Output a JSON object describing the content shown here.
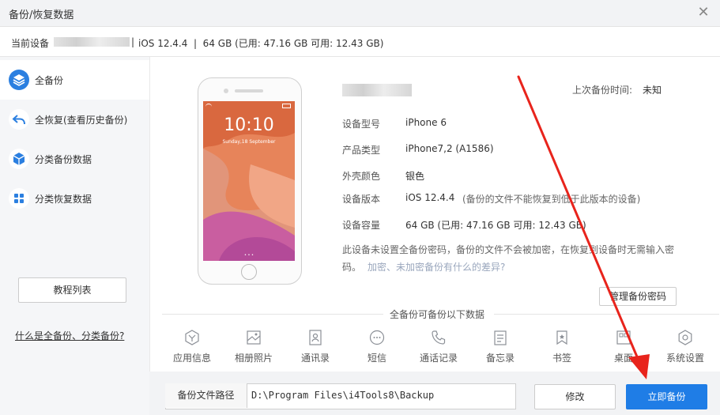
{
  "window": {
    "title": "备份/恢复数据",
    "close_icon": "close-icon"
  },
  "device_bar": {
    "label": "当前设备",
    "separator": "|",
    "info": "iOS 12.4.4  |  64 GB (已用: 47.16 GB 可用: 12.43 GB)"
  },
  "sidebar": {
    "items": [
      {
        "label": "全备份",
        "icon": "layers-icon",
        "active": true
      },
      {
        "label": "全恢复(查看历史备份)",
        "icon": "undo-icon",
        "active": false
      },
      {
        "label": "分类备份数据",
        "icon": "cube-icon",
        "active": false
      },
      {
        "label": "分类恢复数据",
        "icon": "grid-icon",
        "active": false
      }
    ],
    "tutorial_label": "教程列表",
    "faq_link": "什么是全备份、分类备份?"
  },
  "phone": {
    "time": "10:10",
    "date": "Sunday,18 September",
    "page_dots": "• • •"
  },
  "device_info": {
    "last_backup_label": "上次备份时间:",
    "last_backup_value": "未知",
    "rows": [
      {
        "label": "设备型号",
        "value": "iPhone 6"
      },
      {
        "label": "产品类型",
        "value": "iPhone7,2 (A1586)"
      },
      {
        "label": "外壳颜色",
        "value": "银色"
      },
      {
        "label": "设备版本",
        "value": "iOS 12.4.4",
        "note": "(备份的文件不能恢复到低于此版本的设备)"
      },
      {
        "label": "设备容量",
        "value": "64 GB (已用: 47.16 GB  可用: 12.43 GB)"
      }
    ],
    "password_note": "此设备未设置全备份密码，备份的文件不会被加密，在恢复到设备时无需输入密码。",
    "password_link": "加密、未加密备份有什么的差异?",
    "manage_password_button": "管理备份密码"
  },
  "backup_scope": {
    "title": "全备份可备份以下数据",
    "categories": [
      {
        "label": "应用信息",
        "icon": "app-icon"
      },
      {
        "label": "相册照片",
        "icon": "photo-icon"
      },
      {
        "label": "通讯录",
        "icon": "contacts-icon"
      },
      {
        "label": "短信",
        "icon": "message-icon"
      },
      {
        "label": "通话记录",
        "icon": "phone-icon"
      },
      {
        "label": "备忘录",
        "icon": "notes-icon"
      },
      {
        "label": "书签",
        "icon": "bookmark-icon"
      },
      {
        "label": "桌面",
        "icon": "desktop-icon"
      },
      {
        "label": "系统设置",
        "icon": "settings-icon"
      }
    ]
  },
  "footer": {
    "path_label": "备份文件路径",
    "path_value": "D:\\Program Files\\i4Tools8\\Backup",
    "modify_button": "修改",
    "backup_button": "立即备份"
  },
  "colors": {
    "accent": "#1f7de6",
    "annotation_arrow": "#e8241c"
  }
}
